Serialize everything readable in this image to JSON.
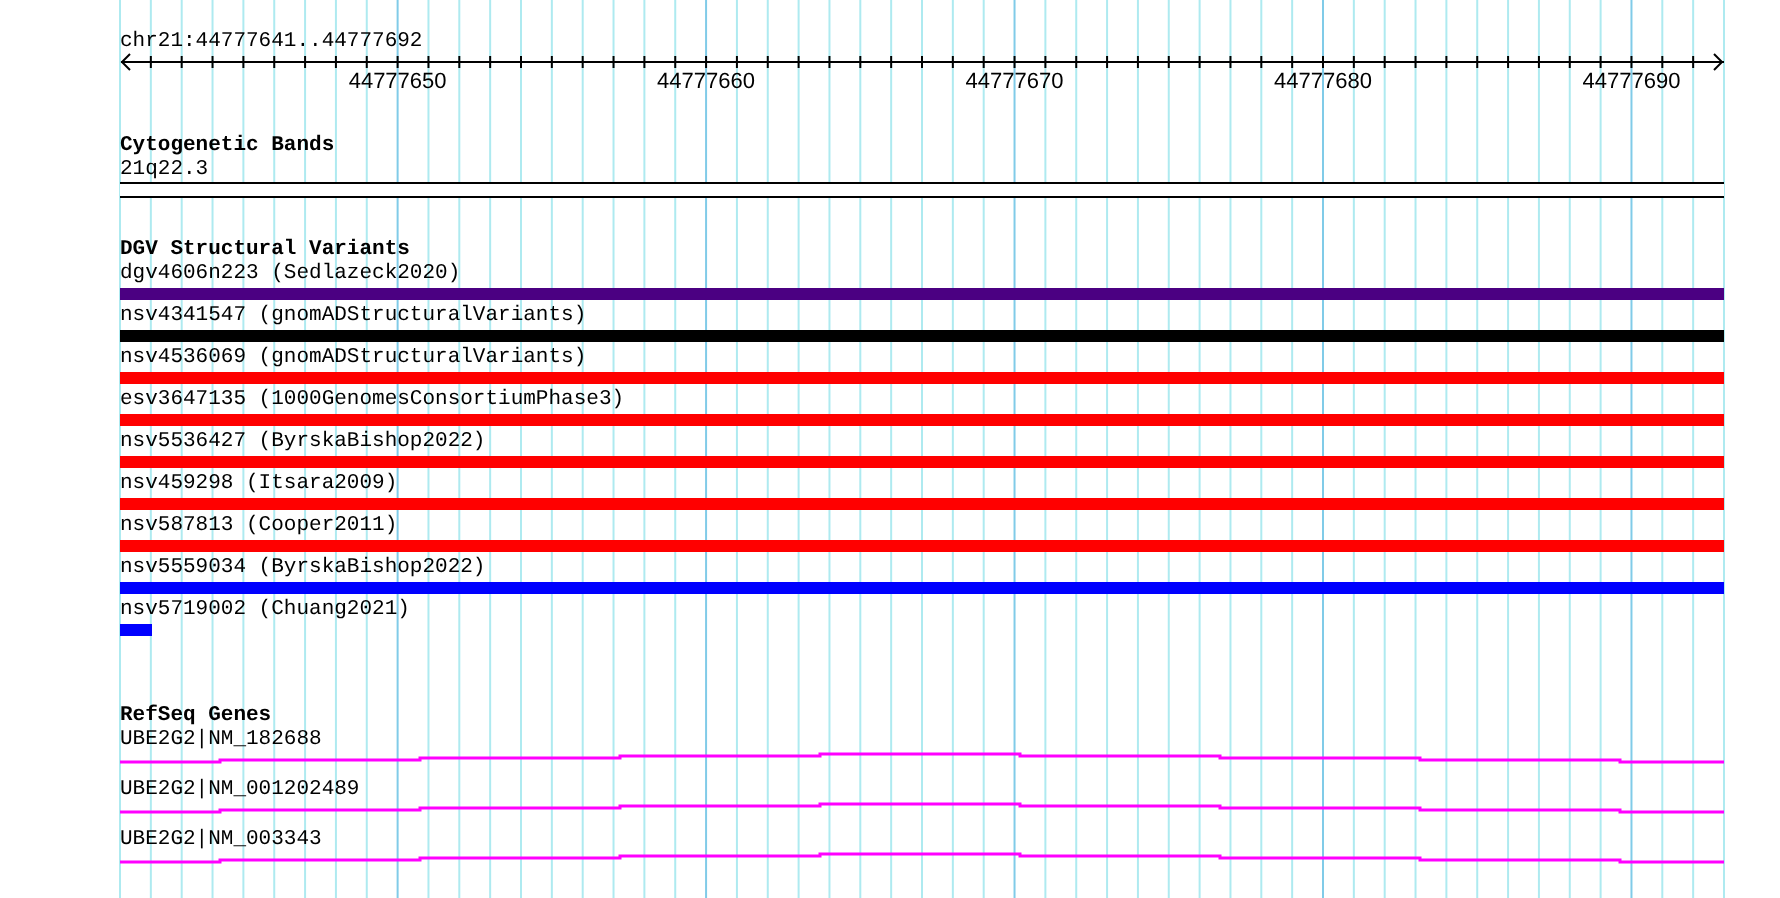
{
  "location": "chr21:44777641..44777692",
  "ruler": {
    "ticks": [
      "44777650",
      "44777660",
      "44777670",
      "44777680",
      "44777690"
    ]
  },
  "cytogenetic_bands": {
    "title": "Cytogenetic Bands",
    "bands": [
      {
        "label": "21q22.3"
      }
    ]
  },
  "dgv_structural_variants": {
    "title": "DGV Structural Variants",
    "variants": [
      {
        "label": "dgv4606n223 (Sedlazeck2020)",
        "color": "#4b0082",
        "kind": "full"
      },
      {
        "label": "nsv4341547 (gnomADStructuralVariants)",
        "color": "#000000",
        "kind": "full"
      },
      {
        "label": "nsv4536069 (gnomADStructuralVariants)",
        "color": "#ff0000",
        "kind": "full"
      },
      {
        "label": "esv3647135 (1000GenomesConsortiumPhase3)",
        "color": "#ff0000",
        "kind": "full"
      },
      {
        "label": "nsv5536427 (ByrskaBishop2022)",
        "color": "#ff0000",
        "kind": "full"
      },
      {
        "label": "nsv459298 (Itsara2009)",
        "color": "#ff0000",
        "kind": "full"
      },
      {
        "label": "nsv587813 (Cooper2011)",
        "color": "#ff0000",
        "kind": "full"
      },
      {
        "label": "nsv5559034 (ByrskaBishop2022)",
        "color": "#0000ff",
        "kind": "full"
      },
      {
        "label": "nsv5719002 (Chuang2021)",
        "color": "#0000ff",
        "kind": "short"
      }
    ]
  },
  "refseq_genes": {
    "title": "RefSeq Genes",
    "transcripts": [
      {
        "label": "UBE2G2|NM_182688"
      },
      {
        "label": "UBE2G2|NM_001202489"
      },
      {
        "label": "UBE2G2|NM_003343"
      }
    ]
  }
}
